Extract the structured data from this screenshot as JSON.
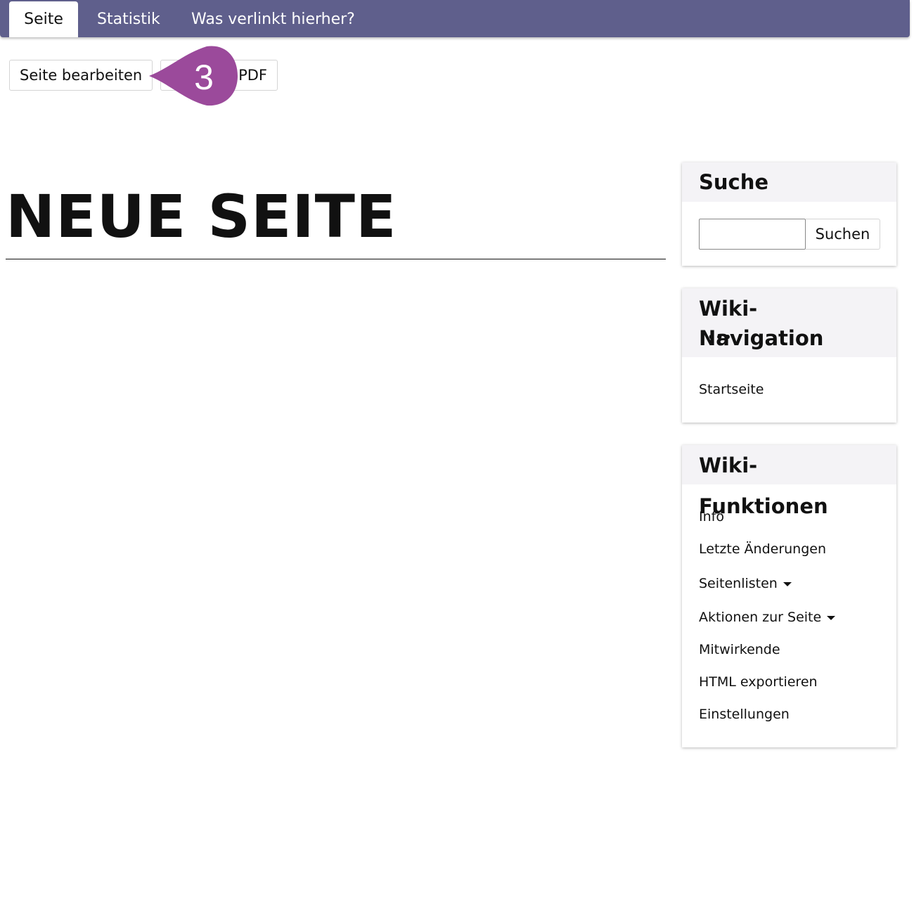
{
  "tabs": {
    "active": "Seite",
    "statistik": "Statistik",
    "links_here": "Was verlinkt hierher?"
  },
  "actions": {
    "edit": "Seite bearbeiten",
    "pdf": "PDF"
  },
  "callout": {
    "number": "3",
    "color": "#9b4a9b"
  },
  "page": {
    "title": "NEUE SEITE"
  },
  "sidebar": {
    "search": {
      "title": "Suche",
      "input_value": "",
      "button": "Suchen"
    },
    "navigation": {
      "title": "Wiki-Navigation",
      "more": "•••",
      "items": [
        "Startseite"
      ]
    },
    "functions": {
      "title": "Wiki-Funktionen",
      "items": [
        "Info",
        "Letzte Änderungen",
        "Seitenlisten",
        "Aktionen zur Seite",
        "Mitwirkende",
        "HTML exportieren",
        "Einstellungen"
      ]
    }
  },
  "colors": {
    "tabbar": "#5f5f8c",
    "panel_header": "#f4f3f6"
  }
}
